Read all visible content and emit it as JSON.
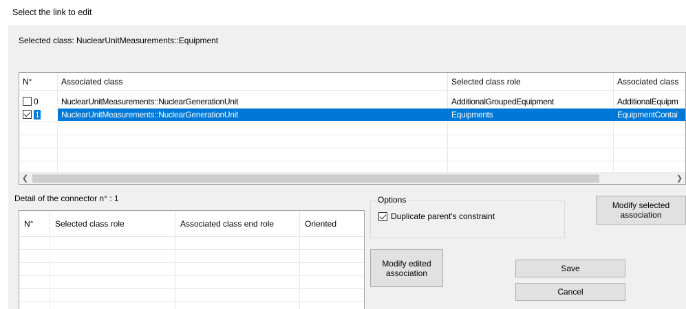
{
  "window": {
    "title": "Select the link to edit"
  },
  "selected_class": "Selected class: NuclearUnitMeasurements::Equipment",
  "links_grid": {
    "columns": [
      "N°",
      "Associated class",
      "Selected class role",
      "Associated class"
    ],
    "rows": [
      {
        "checked": false,
        "num": "0",
        "associated_class": "NuclearUnitMeasurements::NuclearGenerationUnit",
        "selected_role": "AdditionalGroupedEquipment",
        "associated_role": "AdditionalEquipm",
        "selected": false
      },
      {
        "checked": true,
        "num": "1",
        "associated_class": "NuclearUnitMeasurements::NuclearGenerationUnit",
        "selected_role": "Equipments",
        "associated_role": "EquipmentContai",
        "selected": true
      }
    ],
    "scroll_left_icon": "chevron-left-icon",
    "scroll_right_icon": "chevron-right-icon"
  },
  "detail": {
    "label": "Detail of the connector n° : 1",
    "columns": [
      "N°",
      "Selected class role",
      "Associated class end role",
      "Oriented"
    ]
  },
  "options": {
    "legend": "Options",
    "duplicate_label": "Duplicate parent's constraint",
    "duplicate_checked": true
  },
  "buttons": {
    "modify_selected": "Modify selected association",
    "modify_edited": "Modify edited association",
    "save": "Save",
    "cancel": "Cancel"
  }
}
